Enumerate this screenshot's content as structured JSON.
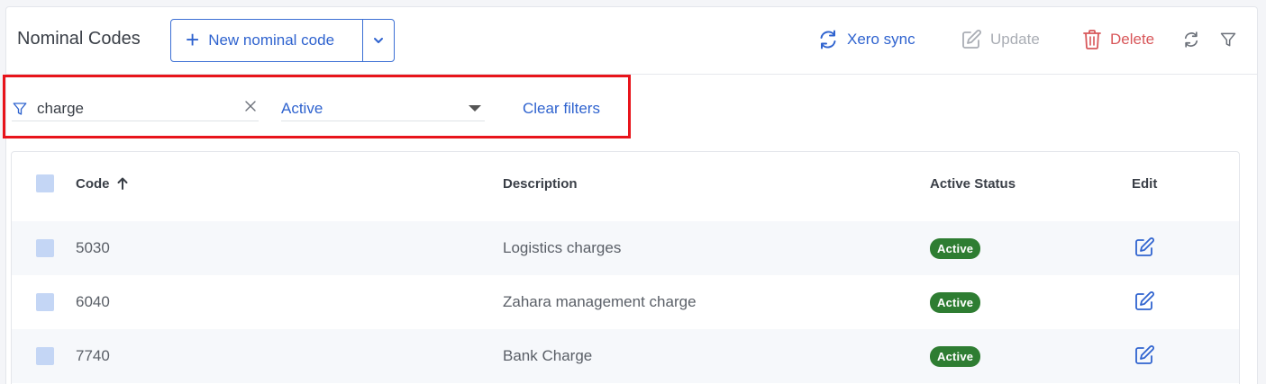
{
  "header": {
    "title": "Nominal Codes",
    "new_button_label": "New nominal code",
    "actions": {
      "xero_sync": "Xero sync",
      "update": "Update",
      "delete": "Delete"
    }
  },
  "filters": {
    "search_value": "charge",
    "status_selected": "Active",
    "clear_label": "Clear filters"
  },
  "table": {
    "columns": [
      "Code",
      "Description",
      "Active Status",
      "Edit"
    ],
    "sort_column": "Code",
    "sort_direction": "ascending",
    "rows": [
      {
        "code": "5030",
        "description": "Logistics charges",
        "status": "Active"
      },
      {
        "code": "6040",
        "description": "Zahara management charge",
        "status": "Active"
      },
      {
        "code": "7740",
        "description": "Bank Charge",
        "status": "Active"
      }
    ]
  },
  "colors": {
    "accent": "#2f63cf",
    "danger": "#d8575a",
    "disabled": "#a9adb4",
    "active_badge": "#2e7d32",
    "highlight_border": "#e8141b"
  },
  "icons": {
    "new": "plus-icon",
    "split": "chevron-down-icon",
    "xero": "sync-icon",
    "update": "edit-icon",
    "delete": "trash-icon",
    "refresh": "refresh-icon",
    "filter": "filter-icon",
    "clear": "close-icon",
    "sort": "arrow-up-icon",
    "edit": "edit-icon"
  }
}
